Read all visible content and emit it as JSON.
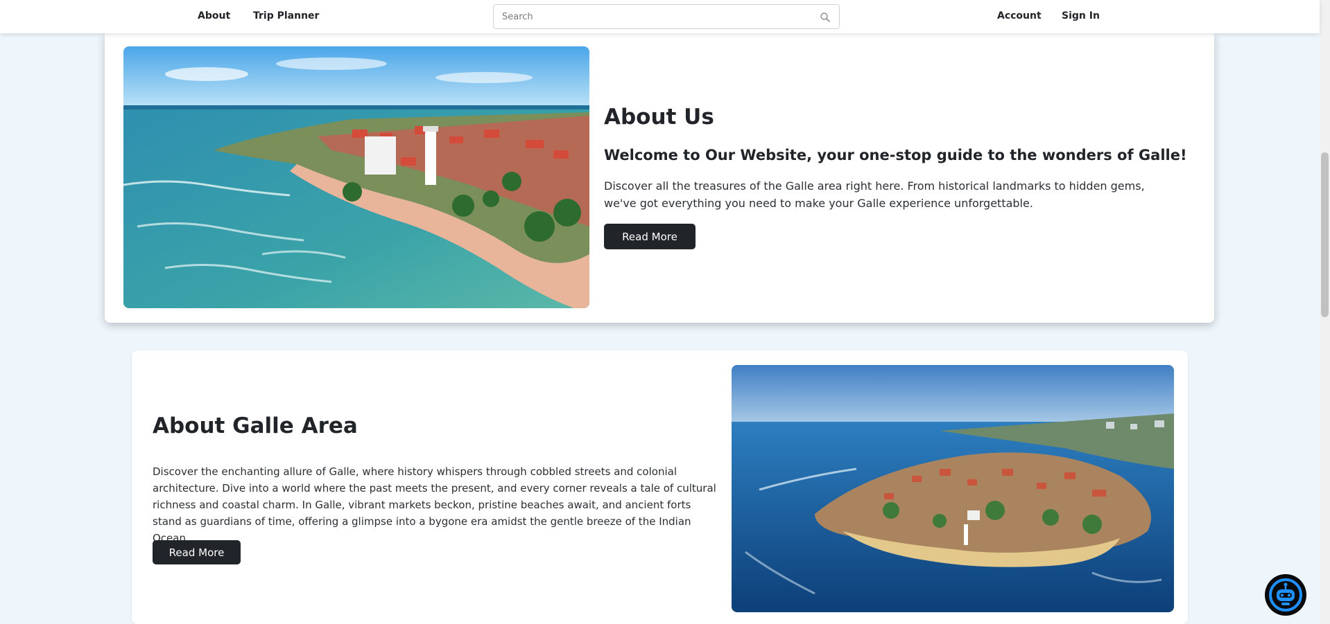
{
  "nav": {
    "about": "About",
    "trip_planner": "Trip Planner",
    "account": "Account",
    "sign_in": "Sign In"
  },
  "search": {
    "placeholder": "Search",
    "value": ""
  },
  "about_us": {
    "title": "About Us",
    "subtitle": "Welcome to Our Website, your one-stop guide to the wonders of Galle!",
    "text": "Discover all the treasures of the Galle area right here. From historical landmarks to hidden gems, we've got everything you need to make your Galle experience unforgettable.",
    "button": "Read More"
  },
  "about_galle": {
    "title": "About Galle Area",
    "text": "Discover the enchanting allure of Galle, where history whispers through cobbled streets and colonial architecture. Dive into a world where the past meets the present, and every corner reveals a tale of cultural richness and coastal charm. In Galle, vibrant markets beckon, pristine beaches await, and ancient forts stand as guardians of time, offering a glimpse into a bygone era amidst the gentle breeze of the Indian Ocean.",
    "button": "Read More"
  },
  "colors": {
    "page_bg": "#eef6fc",
    "button_bg": "#212529",
    "chatbot_accent": "#1e90ff"
  }
}
